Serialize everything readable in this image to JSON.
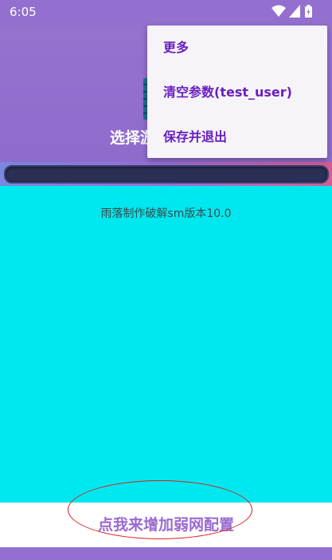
{
  "status_bar": {
    "time": "6:05",
    "icons": [
      "wifi-icon",
      "signal-icon",
      "battery-icon"
    ]
  },
  "header": {
    "title": "选择游"
  },
  "progress": {
    "value": 0
  },
  "content": {
    "version_text": "雨落制作破解sm版本10.0"
  },
  "bottom": {
    "add_button_label": "点我来增加弱网配置"
  },
  "menu": {
    "items": [
      {
        "label": "更多"
      },
      {
        "label": "清空参数(test_user)"
      },
      {
        "label": "保存并退出"
      }
    ]
  },
  "colors": {
    "background": "#9370cf",
    "content": "#00e8ef",
    "menu_text": "#6a1fc0",
    "accent": "#9a6ad0",
    "annotation": "#d62020"
  }
}
